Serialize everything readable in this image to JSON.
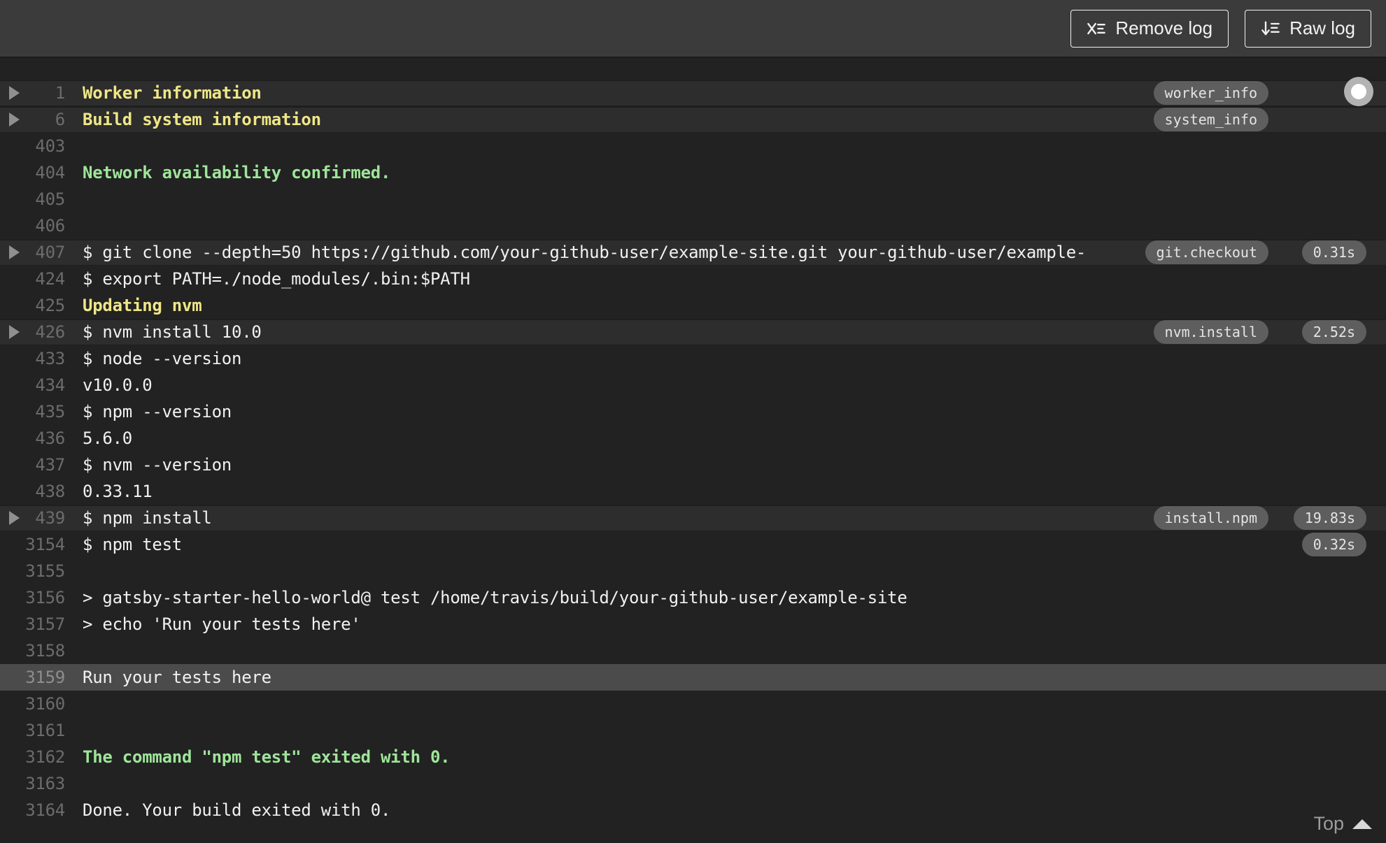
{
  "toolbar": {
    "remove_log_label": "Remove log",
    "raw_log_label": "Raw log"
  },
  "log": {
    "rows": [
      {
        "line": "1",
        "text": "Worker information",
        "style": "yellow",
        "arrow": true,
        "highlight": true,
        "tag": "worker_info"
      },
      {
        "line": "6",
        "text": "Build system information",
        "style": "yellow",
        "arrow": true,
        "highlight": true,
        "tag": "system_info"
      },
      {
        "line": "403",
        "text": ""
      },
      {
        "line": "404",
        "text": "Network availability confirmed.",
        "style": "green"
      },
      {
        "line": "405",
        "text": ""
      },
      {
        "line": "406",
        "text": ""
      },
      {
        "line": "407",
        "text": "$ git clone --depth=50 https://github.com/your-github-user/example-site.git your-github-user/example-",
        "arrow": true,
        "highlight": true,
        "tag": "git.checkout",
        "time": "0.31s"
      },
      {
        "line": "424",
        "text": "$ export PATH=./node_modules/.bin:$PATH"
      },
      {
        "line": "425",
        "text": "Updating nvm",
        "style": "yellow"
      },
      {
        "line": "426",
        "text": "$ nvm install 10.0",
        "arrow": true,
        "highlight": true,
        "tag": "nvm.install",
        "time": "2.52s"
      },
      {
        "line": "433",
        "text": "$ node --version"
      },
      {
        "line": "434",
        "text": "v10.0.0"
      },
      {
        "line": "435",
        "text": "$ npm --version"
      },
      {
        "line": "436",
        "text": "5.6.0"
      },
      {
        "line": "437",
        "text": "$ nvm --version"
      },
      {
        "line": "438",
        "text": "0.33.11"
      },
      {
        "line": "439",
        "text": "$ npm install",
        "arrow": true,
        "highlight": true,
        "tag": "install.npm",
        "time": "19.83s"
      },
      {
        "line": "3154",
        "text": "$ npm test",
        "time": "0.32s"
      },
      {
        "line": "3155",
        "text": ""
      },
      {
        "line": "3156",
        "text": "> gatsby-starter-hello-world@ test /home/travis/build/your-github-user/example-site"
      },
      {
        "line": "3157",
        "text": "> echo 'Run your tests here'"
      },
      {
        "line": "3158",
        "text": ""
      },
      {
        "line": "3159",
        "text": "Run your tests here",
        "selected": true
      },
      {
        "line": "3160",
        "text": ""
      },
      {
        "line": "3161",
        "text": ""
      },
      {
        "line": "3162",
        "text": "The command \"npm test\" exited with 0.",
        "style": "green"
      },
      {
        "line": "3163",
        "text": ""
      },
      {
        "line": "3164",
        "text": "Done. Your build exited with 0."
      }
    ]
  },
  "footer": {
    "top_label": "Top"
  },
  "colors": {
    "header_bg": "#3b3b3b",
    "log_bg": "#222222",
    "highlight_row": "#2d2d2d",
    "selected_row": "#4b4b4b",
    "text_default": "#f1f1f1",
    "text_yellow": "#efe687",
    "text_green": "#9fe59a",
    "line_number": "#6c6c6c",
    "badge_bg": "#5e5e5e"
  }
}
